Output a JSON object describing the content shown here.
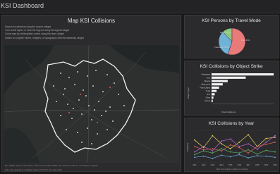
{
  "app": {
    "title": "KSI Dashboard"
  },
  "map_panel": {
    "title": "Map KSI Collisions",
    "instructions": [
      "Search an address using the search widget",
      "Turn on/off layers or view the legend using the legend widget",
      "Zoom map by clicking/then select using the layer widget",
      "Switch to a lighter theme, imagery, or topography with the basemap widget"
    ],
    "attribution": "Esri, HERE, Garmin, FAO, NOAA, USGS, Esri Canada, MNRF, City of Toronto, NRCan, York Region | Vaughan",
    "footnote": "Note: data updated as of collision data by KSI/CITY from 2011-2020"
  },
  "travel_panel": {
    "title": "KSI Persons by Travel Mode",
    "pie_labels": [
      "Bicycle 12%",
      "Auto 33%",
      "Pedestrian 55%"
    ]
  },
  "object_panel": {
    "title": "KSI Collisions by Object Strike",
    "y_axis": "Object Type",
    "x_axis": "Total Collisions"
  },
  "year_panel": {
    "title": "KSI Collisions by Year",
    "y_axis": "Collisions",
    "footnote": "Note: Some data is subject to rounding"
  },
  "chart_data": [
    {
      "type": "pie",
      "title": "KSI Persons by Travel Mode",
      "labels": [
        "Pedestrian",
        "Auto",
        "Bicycle"
      ],
      "values": [
        55,
        33,
        12
      ],
      "colors": [
        "#e97a7a",
        "#6fb3d6",
        "#8fc97f"
      ]
    },
    {
      "type": "bar",
      "title": "KSI Collisions by Object Strike",
      "orientation": "horizontal",
      "categories": [
        "Pedestrian",
        "Auto",
        "Bicycle",
        "Motorcycle",
        "Fixed Object",
        "Truck",
        "Bus",
        "Other",
        "Animal"
      ],
      "values": [
        100,
        55,
        26,
        18,
        12,
        8,
        5,
        3,
        2
      ],
      "color": "#f0f0f0",
      "xlabel": "Total Collisions",
      "ylabel": "Object Type"
    },
    {
      "type": "line",
      "title": "KSI Collisions by Year",
      "categories": [
        "2011",
        "2012",
        "2013",
        "2014",
        "2015",
        "2016",
        "2017",
        "2018",
        "2019",
        "2020"
      ],
      "ylim": [
        0,
        60
      ],
      "ylabel": "Collisions",
      "series": [
        {
          "color": "#e8d45a",
          "values": [
            42,
            28,
            50,
            35,
            26,
            38,
            52,
            30,
            45,
            47
          ]
        },
        {
          "color": "#c066d6",
          "values": [
            20,
            30,
            22,
            40,
            44,
            30,
            35,
            25,
            38,
            50
          ]
        },
        {
          "color": "#e06060",
          "values": [
            30,
            24,
            26,
            22,
            33,
            28,
            18,
            30,
            34,
            38
          ]
        },
        {
          "color": "#58b368",
          "values": [
            15,
            22,
            18,
            26,
            20,
            18,
            24,
            16,
            23,
            20
          ]
        },
        {
          "color": "#6aa7e0",
          "values": [
            10,
            12,
            8,
            14,
            11,
            15,
            9,
            13,
            12,
            10
          ]
        }
      ]
    }
  ]
}
